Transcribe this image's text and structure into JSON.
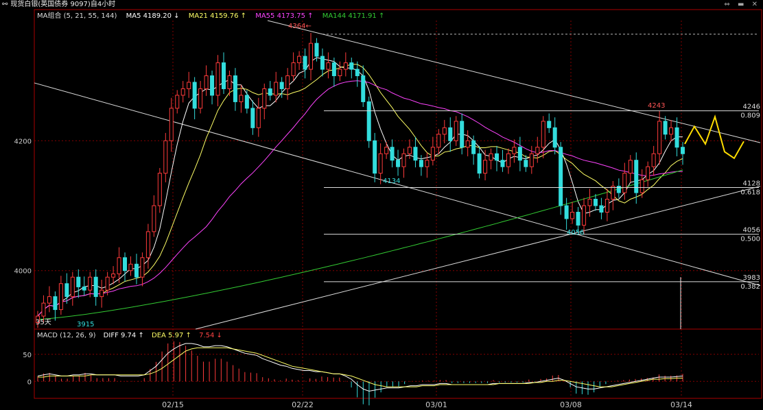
{
  "window": {
    "title": "现货白银(英国债券 9097)自4小时",
    "buttons": "⇔ ▬ ✕"
  },
  "ma_legend": {
    "label": "MA组合 (5, 21, 55, 144)",
    "ma5": "MA5 4189.20 ↓",
    "ma21": "MA21 4159.76 ↑",
    "ma55": "MA55 4173.75 ↑",
    "ma144": "MA144 4171.91 ↑",
    "colors": {
      "ma5": "#ffffff",
      "ma21": "#ffff66",
      "ma55": "#ff44ff",
      "ma144": "#33cc33"
    }
  },
  "macd_legend": {
    "label": "MACD (12, 26, 9)",
    "diff": "DIFF  9.74 ↑",
    "dea": "DEA  5.97 ↑",
    "macd": "7.54 ↓"
  },
  "chart_data": [
    {
      "type": "candlestick",
      "title": "现货白银(英国债券 9097)自4小时",
      "y_ticks": [
        4000,
        4200
      ],
      "ylim": [
        3910,
        4385
      ],
      "x_ticks": [
        "02/15",
        "02/22",
        "03/01",
        "03/08",
        "03/14"
      ],
      "high_marker": "4364",
      "low_marker": "3915",
      "bars_label": "35天",
      "annotations": [
        "4134",
        "4056",
        "4243"
      ],
      "fib_levels": [
        {
          "price": 4246,
          "ratio": "0.809"
        },
        {
          "price": 4128,
          "ratio": "0.618"
        },
        {
          "price": 4056,
          "ratio": "0.500"
        },
        {
          "price": 3983,
          "ratio": "0.382"
        }
      ],
      "close_path": [
        3930,
        3950,
        3960,
        3940,
        3980,
        3960,
        3990,
        3975,
        3970,
        3990,
        3960,
        3970,
        3990,
        3995,
        4020,
        4000,
        4010,
        3990,
        4020,
        4060,
        4100,
        4150,
        4200,
        4250,
        4270,
        4280,
        4290,
        4250,
        4280,
        4300,
        4270,
        4320,
        4280,
        4300,
        4260,
        4270,
        4250,
        4220,
        4250,
        4280,
        4270,
        4290,
        4280,
        4300,
        4320,
        4330,
        4310,
        4350,
        4330,
        4310,
        4320,
        4300,
        4310,
        4320,
        4310,
        4300,
        4260,
        4200,
        4150,
        4180,
        4190,
        4170,
        4160,
        4180,
        4190,
        4170,
        4160,
        4170,
        4190,
        4210,
        4220,
        4200,
        4230,
        4190,
        4200,
        4180,
        4150,
        4170,
        4180,
        4170,
        4160,
        4180,
        4190,
        4170,
        4160,
        4180,
        4190,
        4230,
        4220,
        4190,
        4100,
        4080,
        4090,
        4070,
        4100,
        4110,
        4100,
        4090,
        4110,
        4130,
        4120,
        4150,
        4170,
        4120,
        4140,
        4160,
        4180,
        4230,
        4210,
        4220,
        4190,
        4180
      ]
    },
    {
      "type": "bar",
      "title": "MACD (12, 26, 9)",
      "y_ticks": [
        0,
        50
      ],
      "ylim": [
        -30,
        75
      ],
      "diff_path": [
        10,
        12,
        14,
        12,
        10,
        10,
        12,
        12,
        14,
        14,
        12,
        12,
        12,
        12,
        10,
        10,
        10,
        10,
        12,
        20,
        28,
        40,
        52,
        60,
        66,
        70,
        70,
        68,
        64,
        64,
        66,
        66,
        64,
        60,
        56,
        52,
        50,
        48,
        42,
        38,
        34,
        30,
        28,
        24,
        22,
        20,
        20,
        18,
        18,
        16,
        14,
        14,
        10,
        4,
        -6,
        -14,
        -18,
        -16,
        -14,
        -12,
        -12,
        -12,
        -10,
        -8,
        -8,
        -6,
        -6,
        -6,
        -4,
        -4,
        -6,
        -6,
        -6,
        -6,
        -6,
        -6,
        -6,
        -4,
        -4,
        -4,
        -4,
        -4,
        -4,
        -2,
        -2,
        0,
        2,
        4,
        6,
        2,
        -4,
        -10,
        -12,
        -14,
        -14,
        -12,
        -10,
        -8,
        -6,
        -4,
        -2,
        0,
        2,
        4,
        6,
        8,
        8,
        8,
        9,
        10
      ],
      "dea_path": [
        8,
        8,
        10,
        10,
        10,
        10,
        10,
        10,
        10,
        12,
        12,
        12,
        12,
        12,
        12,
        12,
        12,
        12,
        12,
        14,
        18,
        24,
        32,
        40,
        48,
        56,
        60,
        62,
        62,
        62,
        62,
        62,
        62,
        60,
        58,
        56,
        54,
        52,
        48,
        44,
        40,
        36,
        32,
        28,
        26,
        24,
        22,
        20,
        18,
        16,
        14,
        14,
        12,
        10,
        6,
        2,
        -2,
        -6,
        -8,
        -10,
        -10,
        -10,
        -10,
        -10,
        -10,
        -8,
        -8,
        -8,
        -6,
        -6,
        -6,
        -6,
        -6,
        -6,
        -6,
        -6,
        -6,
        -6,
        -4,
        -4,
        -4,
        -4,
        -4,
        -4,
        -2,
        -2,
        0,
        0,
        2,
        2,
        0,
        -2,
        -4,
        -6,
        -8,
        -10,
        -10,
        -10,
        -8,
        -6,
        -4,
        -2,
        0,
        2,
        4,
        4,
        5,
        5,
        6,
        6
      ]
    }
  ]
}
